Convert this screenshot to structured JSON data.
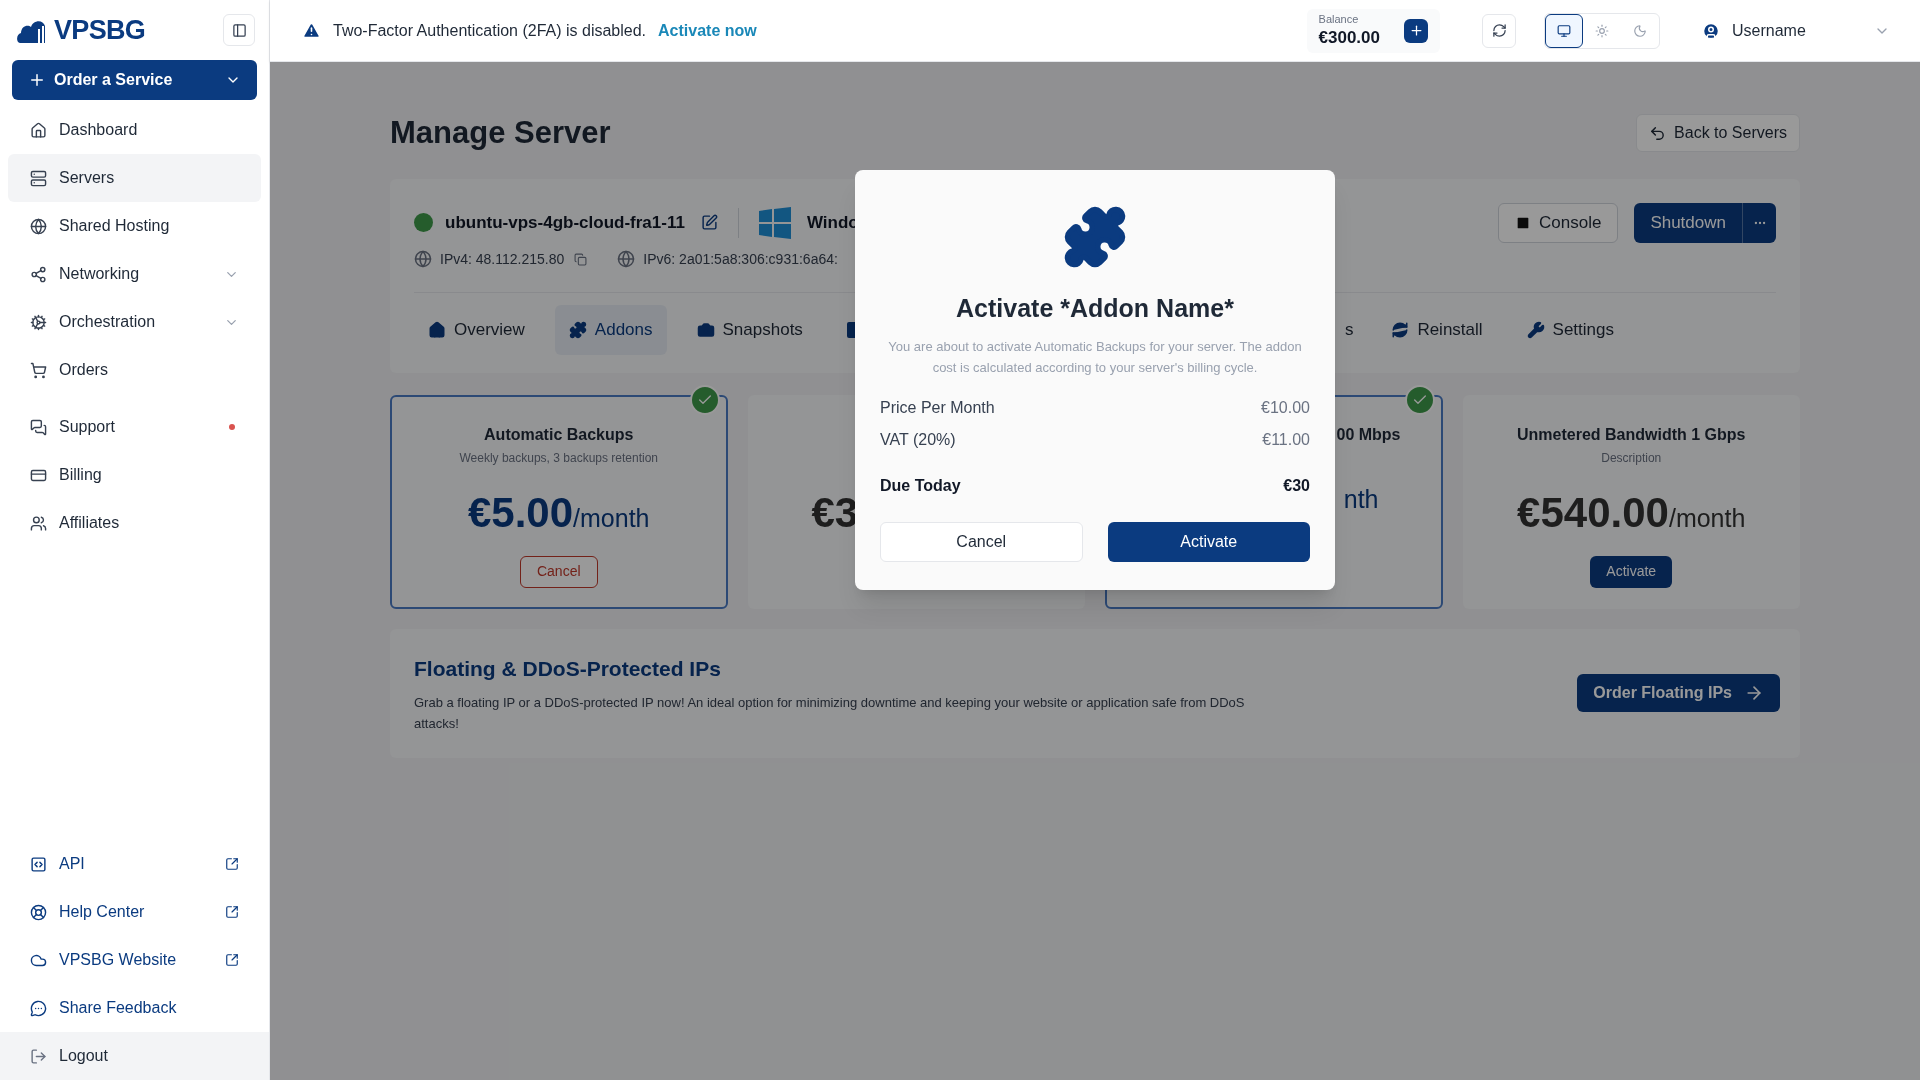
{
  "sidebar": {
    "logo": "VPSBG",
    "order_button": "Order a Service",
    "sections": [
      [
        {
          "label": "Dashboard",
          "kind": "link",
          "selected": false,
          "notification": false
        },
        {
          "label": "Servers",
          "kind": "link",
          "selected": true,
          "notification": false
        },
        {
          "label": "Shared Hosting",
          "kind": "link",
          "selected": false,
          "notification": false
        },
        {
          "label": "Networking",
          "kind": "group",
          "selected": false,
          "notification": false
        },
        {
          "label": "Orchestration",
          "kind": "group",
          "selected": false,
          "notification": false
        },
        {
          "label": "Orders",
          "kind": "link",
          "selected": false,
          "notification": false
        }
      ],
      [
        {
          "label": "Support",
          "kind": "link",
          "selected": false,
          "notification": true
        },
        {
          "label": "Billing",
          "kind": "link",
          "selected": false,
          "notification": false
        },
        {
          "label": "Affiliates",
          "kind": "link",
          "selected": false,
          "notification": false
        }
      ]
    ],
    "footer_items": [
      {
        "label": "API",
        "kind": "external"
      },
      {
        "label": "Help Center",
        "kind": "external"
      },
      {
        "label": "VPSBG Website",
        "kind": "external"
      },
      {
        "label": "Share Feedback",
        "kind": "link"
      },
      {
        "label": "Logout",
        "kind": "action"
      }
    ]
  },
  "topbar": {
    "alert": {
      "text": "Two-Factor Authentication (2FA) is disabled.",
      "link": "Activate now"
    },
    "balance": {
      "label": "Balance",
      "amount": "€300.00"
    },
    "theme_options": [
      {
        "selected": true
      },
      {
        "selected": false
      },
      {
        "selected": false
      }
    ],
    "user": "Username"
  },
  "page": {
    "title": "Manage Server",
    "back_button": "Back to Servers"
  },
  "server": {
    "online": true,
    "name": "ubuntu-vps-4gb-cloud-fra1-11",
    "os": "Windo",
    "ipv4": "IPv4: 48.112.215.80",
    "ipv6": "IPv6: 2a01:5a8:306:c931:6a64:",
    "console": "Console",
    "shutdown": "Shutdown",
    "tabs": [
      {
        "label": "Overview",
        "kind": "full",
        "selected": false
      },
      {
        "label": "Addons",
        "kind": "full",
        "selected": true
      },
      {
        "label": "Snapshots",
        "kind": "full",
        "selected": false
      },
      {
        "kind": "icon_only",
        "selected": false
      },
      {
        "label": "s",
        "kind": "fragment",
        "selected": false
      },
      {
        "label": "Reinstall",
        "kind": "full",
        "selected": false
      },
      {
        "label": "Settings",
        "kind": "full",
        "selected": false
      }
    ]
  },
  "addons": [
    {
      "kind": "full",
      "title": "Automatic Backups",
      "description": "Weekly backups, 3 backups retention",
      "price": "€5.00",
      "period": "/month",
      "action": "Cancel",
      "destructive": true,
      "active": true
    },
    {
      "kind": "clipped_right",
      "price": "€3",
      "active": false
    },
    {
      "kind": "clipped_left",
      "title": "00 Mbps",
      "period": "nth",
      "active": true
    },
    {
      "kind": "full",
      "title": "Unmetered Bandwidth 1 Gbps",
      "description": "Description",
      "price": "€540.00",
      "period": "/month",
      "action": "Activate",
      "destructive": false,
      "active": false
    }
  ],
  "promo": {
    "title": "Floating & DDoS-Protected IPs",
    "text": "Grab a floating IP or a DDoS-protected IP now! An ideal option for minimizing downtime and keeping your website or application safe from DDoS attacks!",
    "button": "Order Floating IPs"
  },
  "modal": {
    "title": "Activate *Addon Name*",
    "text": "You are about to activate Automatic Backups for your server. The addon cost is calculated according to your server's billing cycle.",
    "rows": [
      {
        "label": "Price Per Month",
        "value": "€10.00",
        "kind": "line"
      },
      {
        "label": "VAT (20%)",
        "value": "€11.00",
        "kind": "line"
      },
      {
        "label": "Due Today",
        "value": "€30",
        "kind": "total"
      }
    ],
    "cancel": "Cancel",
    "confirm": "Activate"
  }
}
